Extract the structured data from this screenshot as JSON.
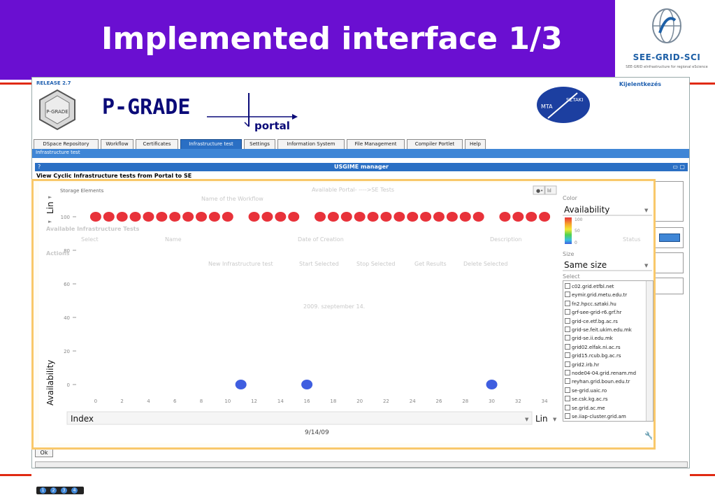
{
  "slide": {
    "title": "Implemented interface 1/3",
    "logo_text": "SEE-GRID-SCI",
    "logo_sub": "SEE-GRID eInfrastructure for regional eScience"
  },
  "portal": {
    "release": "RELEASE 2.7",
    "login": "Kijelentkezés",
    "logo_sub_text": "P-GRADE",
    "wordmark_main": "P-GRADE",
    "wordmark_sub": "portal",
    "mta_left": "MTA",
    "mta_right": "SZTAKI",
    "tabs": [
      {
        "label": "DSpace Repository",
        "active": false
      },
      {
        "label": "Workflow",
        "active": false
      },
      {
        "label": "Certificates",
        "active": false
      },
      {
        "label": "Infrastructure test",
        "active": true
      },
      {
        "label": "Settings",
        "active": false
      },
      {
        "label": "Information System",
        "active": false
      },
      {
        "label": "File Management",
        "active": false
      },
      {
        "label": "Compiler Portlet",
        "active": false
      },
      {
        "label": "Help",
        "active": false
      }
    ],
    "subbar": "Infrastructure test",
    "window_q": "?",
    "window_title": "USGIME manager",
    "window_buttons": "▭ ▢",
    "cyclic_title": "View Cyclic Infrastructure tests from Portal to SE",
    "ok_label": "Ok"
  },
  "background": {
    "available_portal": "Available Portal- ---->SE Tests",
    "name_of_workflow": "Name of the Workflow",
    "available_infra": "Available Infrastructure Tests",
    "columns": [
      "Select",
      "Name",
      "Date of Creation",
      "Description",
      "Status"
    ],
    "actions_label": "Actions",
    "action_buttons": [
      "New Infrastructure test",
      "Start Selected",
      "Stop Selected",
      "Get Results",
      "Delete Selected"
    ],
    "date_text": "2009. szeptember 14."
  },
  "chart_controls": {
    "storage_label": "Storage Elements",
    "y_scale": "Lin",
    "x_scale": "Lin",
    "x_field": "Index",
    "date_label": "9/14/09",
    "color_label": "Color",
    "color_value": "Availability",
    "color_scale": [
      "100",
      "50",
      "0"
    ],
    "size_label": "Size",
    "size_value": "Same size",
    "select_label": "Select",
    "toggle_icons": [
      "scatter-icon",
      "bar-icon"
    ],
    "colors": {
      "high": "#e8323a",
      "low": "#3f5ee0",
      "frame": "#f9c86a",
      "title_bg": "#6a0fd1"
    }
  },
  "storage_elements": [
    "c02.grid.etfbl.net",
    "eymir.grid.metu.edu.tr",
    "fn2.hpcc.sztaki.hu",
    "grf-see-grid-r6.grf.hr",
    "grid-ce.etf.bg.ac.rs",
    "grid-se.feit.ukim.edu.mk",
    "grid-se.ii.edu.mk",
    "grid02.elfak.ni.ac.rs",
    "grid15.rcub.bg.ac.rs",
    "grid2.irb.hr",
    "node04-04.grid.renam.md",
    "reyhan.grid.boun.edu.tr",
    "se-grid.uaic.ro",
    "se.csk.kg.ac.rs",
    "se.grid.ac.me",
    "se.iiap-cluster.grid.am"
  ],
  "chart_data": {
    "type": "scatter",
    "xlabel": "Index",
    "ylabel": "Availability",
    "xlim": [
      -1,
      35
    ],
    "ylim": [
      -5,
      105
    ],
    "xticks": [
      0,
      2,
      4,
      6,
      8,
      10,
      12,
      14,
      16,
      18,
      20,
      22,
      24,
      26,
      28,
      30,
      32,
      34
    ],
    "yticks": [
      0,
      20,
      40,
      60,
      80,
      100
    ],
    "grid": false,
    "points": [
      {
        "x": 0,
        "y": 100
      },
      {
        "x": 1,
        "y": 100
      },
      {
        "x": 2,
        "y": 100
      },
      {
        "x": 3,
        "y": 100
      },
      {
        "x": 4,
        "y": 100
      },
      {
        "x": 5,
        "y": 100
      },
      {
        "x": 6,
        "y": 100
      },
      {
        "x": 7,
        "y": 100
      },
      {
        "x": 8,
        "y": 100
      },
      {
        "x": 9,
        "y": 100
      },
      {
        "x": 10,
        "y": 100
      },
      {
        "x": 11,
        "y": 0
      },
      {
        "x": 12,
        "y": 100
      },
      {
        "x": 13,
        "y": 100
      },
      {
        "x": 14,
        "y": 100
      },
      {
        "x": 15,
        "y": 100
      },
      {
        "x": 16,
        "y": 0
      },
      {
        "x": 17,
        "y": 100
      },
      {
        "x": 18,
        "y": 100
      },
      {
        "x": 19,
        "y": 100
      },
      {
        "x": 20,
        "y": 100
      },
      {
        "x": 21,
        "y": 100
      },
      {
        "x": 22,
        "y": 100
      },
      {
        "x": 23,
        "y": 100
      },
      {
        "x": 24,
        "y": 100
      },
      {
        "x": 25,
        "y": 100
      },
      {
        "x": 26,
        "y": 100
      },
      {
        "x": 27,
        "y": 100
      },
      {
        "x": 28,
        "y": 100
      },
      {
        "x": 29,
        "y": 100
      },
      {
        "x": 30,
        "y": 0
      },
      {
        "x": 31,
        "y": 100
      },
      {
        "x": 32,
        "y": 100
      },
      {
        "x": 33,
        "y": 100
      },
      {
        "x": 34,
        "y": 100
      }
    ]
  },
  "pager": [
    "1",
    "2",
    "3",
    "4"
  ]
}
